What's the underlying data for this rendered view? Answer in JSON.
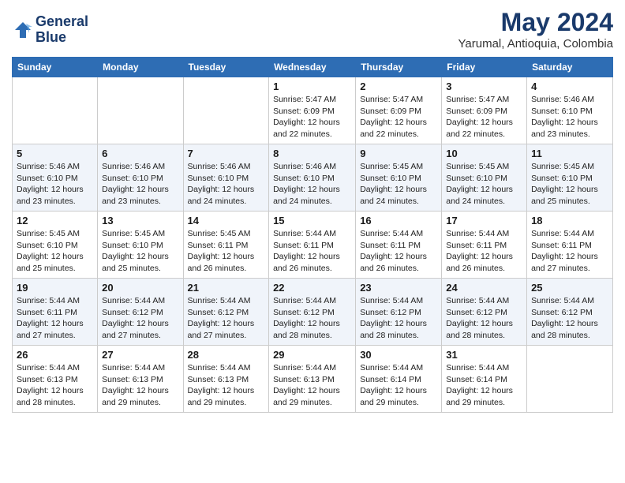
{
  "logo": {
    "name1": "General",
    "name2": "Blue"
  },
  "title": "May 2024",
  "location": "Yarumal, Antioquia, Colombia",
  "weekdays": [
    "Sunday",
    "Monday",
    "Tuesday",
    "Wednesday",
    "Thursday",
    "Friday",
    "Saturday"
  ],
  "weeks": [
    [
      {
        "day": "",
        "info": ""
      },
      {
        "day": "",
        "info": ""
      },
      {
        "day": "",
        "info": ""
      },
      {
        "day": "1",
        "sunrise": "5:47 AM",
        "sunset": "6:09 PM",
        "daylight": "12 hours and 22 minutes."
      },
      {
        "day": "2",
        "sunrise": "5:47 AM",
        "sunset": "6:09 PM",
        "daylight": "12 hours and 22 minutes."
      },
      {
        "day": "3",
        "sunrise": "5:47 AM",
        "sunset": "6:09 PM",
        "daylight": "12 hours and 22 minutes."
      },
      {
        "day": "4",
        "sunrise": "5:46 AM",
        "sunset": "6:10 PM",
        "daylight": "12 hours and 23 minutes."
      }
    ],
    [
      {
        "day": "5",
        "sunrise": "5:46 AM",
        "sunset": "6:10 PM",
        "daylight": "12 hours and 23 minutes."
      },
      {
        "day": "6",
        "sunrise": "5:46 AM",
        "sunset": "6:10 PM",
        "daylight": "12 hours and 23 minutes."
      },
      {
        "day": "7",
        "sunrise": "5:46 AM",
        "sunset": "6:10 PM",
        "daylight": "12 hours and 24 minutes."
      },
      {
        "day": "8",
        "sunrise": "5:46 AM",
        "sunset": "6:10 PM",
        "daylight": "12 hours and 24 minutes."
      },
      {
        "day": "9",
        "sunrise": "5:45 AM",
        "sunset": "6:10 PM",
        "daylight": "12 hours and 24 minutes."
      },
      {
        "day": "10",
        "sunrise": "5:45 AM",
        "sunset": "6:10 PM",
        "daylight": "12 hours and 24 minutes."
      },
      {
        "day": "11",
        "sunrise": "5:45 AM",
        "sunset": "6:10 PM",
        "daylight": "12 hours and 25 minutes."
      }
    ],
    [
      {
        "day": "12",
        "sunrise": "5:45 AM",
        "sunset": "6:10 PM",
        "daylight": "12 hours and 25 minutes."
      },
      {
        "day": "13",
        "sunrise": "5:45 AM",
        "sunset": "6:10 PM",
        "daylight": "12 hours and 25 minutes."
      },
      {
        "day": "14",
        "sunrise": "5:45 AM",
        "sunset": "6:11 PM",
        "daylight": "12 hours and 26 minutes."
      },
      {
        "day": "15",
        "sunrise": "5:44 AM",
        "sunset": "6:11 PM",
        "daylight": "12 hours and 26 minutes."
      },
      {
        "day": "16",
        "sunrise": "5:44 AM",
        "sunset": "6:11 PM",
        "daylight": "12 hours and 26 minutes."
      },
      {
        "day": "17",
        "sunrise": "5:44 AM",
        "sunset": "6:11 PM",
        "daylight": "12 hours and 26 minutes."
      },
      {
        "day": "18",
        "sunrise": "5:44 AM",
        "sunset": "6:11 PM",
        "daylight": "12 hours and 27 minutes."
      }
    ],
    [
      {
        "day": "19",
        "sunrise": "5:44 AM",
        "sunset": "6:11 PM",
        "daylight": "12 hours and 27 minutes."
      },
      {
        "day": "20",
        "sunrise": "5:44 AM",
        "sunset": "6:12 PM",
        "daylight": "12 hours and 27 minutes."
      },
      {
        "day": "21",
        "sunrise": "5:44 AM",
        "sunset": "6:12 PM",
        "daylight": "12 hours and 27 minutes."
      },
      {
        "day": "22",
        "sunrise": "5:44 AM",
        "sunset": "6:12 PM",
        "daylight": "12 hours and 28 minutes."
      },
      {
        "day": "23",
        "sunrise": "5:44 AM",
        "sunset": "6:12 PM",
        "daylight": "12 hours and 28 minutes."
      },
      {
        "day": "24",
        "sunrise": "5:44 AM",
        "sunset": "6:12 PM",
        "daylight": "12 hours and 28 minutes."
      },
      {
        "day": "25",
        "sunrise": "5:44 AM",
        "sunset": "6:12 PM",
        "daylight": "12 hours and 28 minutes."
      }
    ],
    [
      {
        "day": "26",
        "sunrise": "5:44 AM",
        "sunset": "6:13 PM",
        "daylight": "12 hours and 28 minutes."
      },
      {
        "day": "27",
        "sunrise": "5:44 AM",
        "sunset": "6:13 PM",
        "daylight": "12 hours and 29 minutes."
      },
      {
        "day": "28",
        "sunrise": "5:44 AM",
        "sunset": "6:13 PM",
        "daylight": "12 hours and 29 minutes."
      },
      {
        "day": "29",
        "sunrise": "5:44 AM",
        "sunset": "6:13 PM",
        "daylight": "12 hours and 29 minutes."
      },
      {
        "day": "30",
        "sunrise": "5:44 AM",
        "sunset": "6:14 PM",
        "daylight": "12 hours and 29 minutes."
      },
      {
        "day": "31",
        "sunrise": "5:44 AM",
        "sunset": "6:14 PM",
        "daylight": "12 hours and 29 minutes."
      },
      {
        "day": "",
        "info": ""
      }
    ]
  ]
}
